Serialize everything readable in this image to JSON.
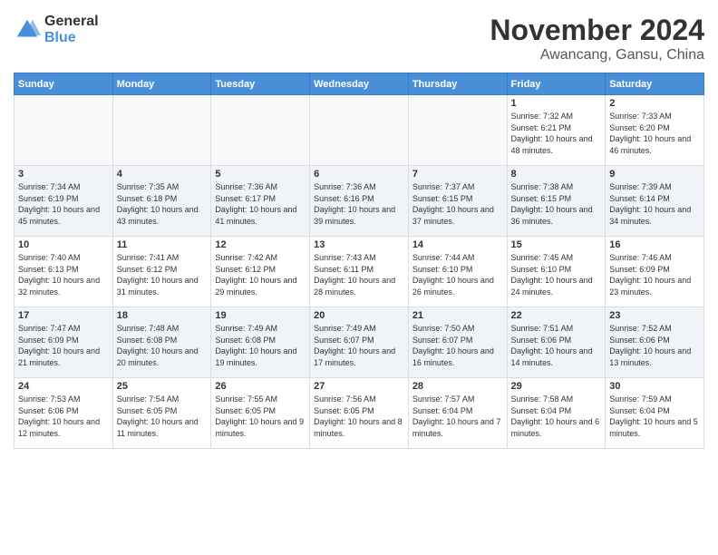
{
  "logo": {
    "general": "General",
    "blue": "Blue"
  },
  "title": "November 2024",
  "location": "Awancang, Gansu, China",
  "weekdays": [
    "Sunday",
    "Monday",
    "Tuesday",
    "Wednesday",
    "Thursday",
    "Friday",
    "Saturday"
  ],
  "days": {
    "1": {
      "sunrise": "7:32 AM",
      "sunset": "6:21 PM",
      "daylight": "10 hours and 48 minutes."
    },
    "2": {
      "sunrise": "7:33 AM",
      "sunset": "6:20 PM",
      "daylight": "10 hours and 46 minutes."
    },
    "3": {
      "sunrise": "7:34 AM",
      "sunset": "6:19 PM",
      "daylight": "10 hours and 45 minutes."
    },
    "4": {
      "sunrise": "7:35 AM",
      "sunset": "6:18 PM",
      "daylight": "10 hours and 43 minutes."
    },
    "5": {
      "sunrise": "7:36 AM",
      "sunset": "6:17 PM",
      "daylight": "10 hours and 41 minutes."
    },
    "6": {
      "sunrise": "7:36 AM",
      "sunset": "6:16 PM",
      "daylight": "10 hours and 39 minutes."
    },
    "7": {
      "sunrise": "7:37 AM",
      "sunset": "6:15 PM",
      "daylight": "10 hours and 37 minutes."
    },
    "8": {
      "sunrise": "7:38 AM",
      "sunset": "6:15 PM",
      "daylight": "10 hours and 36 minutes."
    },
    "9": {
      "sunrise": "7:39 AM",
      "sunset": "6:14 PM",
      "daylight": "10 hours and 34 minutes."
    },
    "10": {
      "sunrise": "7:40 AM",
      "sunset": "6:13 PM",
      "daylight": "10 hours and 32 minutes."
    },
    "11": {
      "sunrise": "7:41 AM",
      "sunset": "6:12 PM",
      "daylight": "10 hours and 31 minutes."
    },
    "12": {
      "sunrise": "7:42 AM",
      "sunset": "6:12 PM",
      "daylight": "10 hours and 29 minutes."
    },
    "13": {
      "sunrise": "7:43 AM",
      "sunset": "6:11 PM",
      "daylight": "10 hours and 28 minutes."
    },
    "14": {
      "sunrise": "7:44 AM",
      "sunset": "6:10 PM",
      "daylight": "10 hours and 26 minutes."
    },
    "15": {
      "sunrise": "7:45 AM",
      "sunset": "6:10 PM",
      "daylight": "10 hours and 24 minutes."
    },
    "16": {
      "sunrise": "7:46 AM",
      "sunset": "6:09 PM",
      "daylight": "10 hours and 23 minutes."
    },
    "17": {
      "sunrise": "7:47 AM",
      "sunset": "6:09 PM",
      "daylight": "10 hours and 21 minutes."
    },
    "18": {
      "sunrise": "7:48 AM",
      "sunset": "6:08 PM",
      "daylight": "10 hours and 20 minutes."
    },
    "19": {
      "sunrise": "7:49 AM",
      "sunset": "6:08 PM",
      "daylight": "10 hours and 19 minutes."
    },
    "20": {
      "sunrise": "7:49 AM",
      "sunset": "6:07 PM",
      "daylight": "10 hours and 17 minutes."
    },
    "21": {
      "sunrise": "7:50 AM",
      "sunset": "6:07 PM",
      "daylight": "10 hours and 16 minutes."
    },
    "22": {
      "sunrise": "7:51 AM",
      "sunset": "6:06 PM",
      "daylight": "10 hours and 14 minutes."
    },
    "23": {
      "sunrise": "7:52 AM",
      "sunset": "6:06 PM",
      "daylight": "10 hours and 13 minutes."
    },
    "24": {
      "sunrise": "7:53 AM",
      "sunset": "6:06 PM",
      "daylight": "10 hours and 12 minutes."
    },
    "25": {
      "sunrise": "7:54 AM",
      "sunset": "6:05 PM",
      "daylight": "10 hours and 11 minutes."
    },
    "26": {
      "sunrise": "7:55 AM",
      "sunset": "6:05 PM",
      "daylight": "10 hours and 9 minutes."
    },
    "27": {
      "sunrise": "7:56 AM",
      "sunset": "6:05 PM",
      "daylight": "10 hours and 8 minutes."
    },
    "28": {
      "sunrise": "7:57 AM",
      "sunset": "6:04 PM",
      "daylight": "10 hours and 7 minutes."
    },
    "29": {
      "sunrise": "7:58 AM",
      "sunset": "6:04 PM",
      "daylight": "10 hours and 6 minutes."
    },
    "30": {
      "sunrise": "7:59 AM",
      "sunset": "6:04 PM",
      "daylight": "10 hours and 5 minutes."
    }
  }
}
